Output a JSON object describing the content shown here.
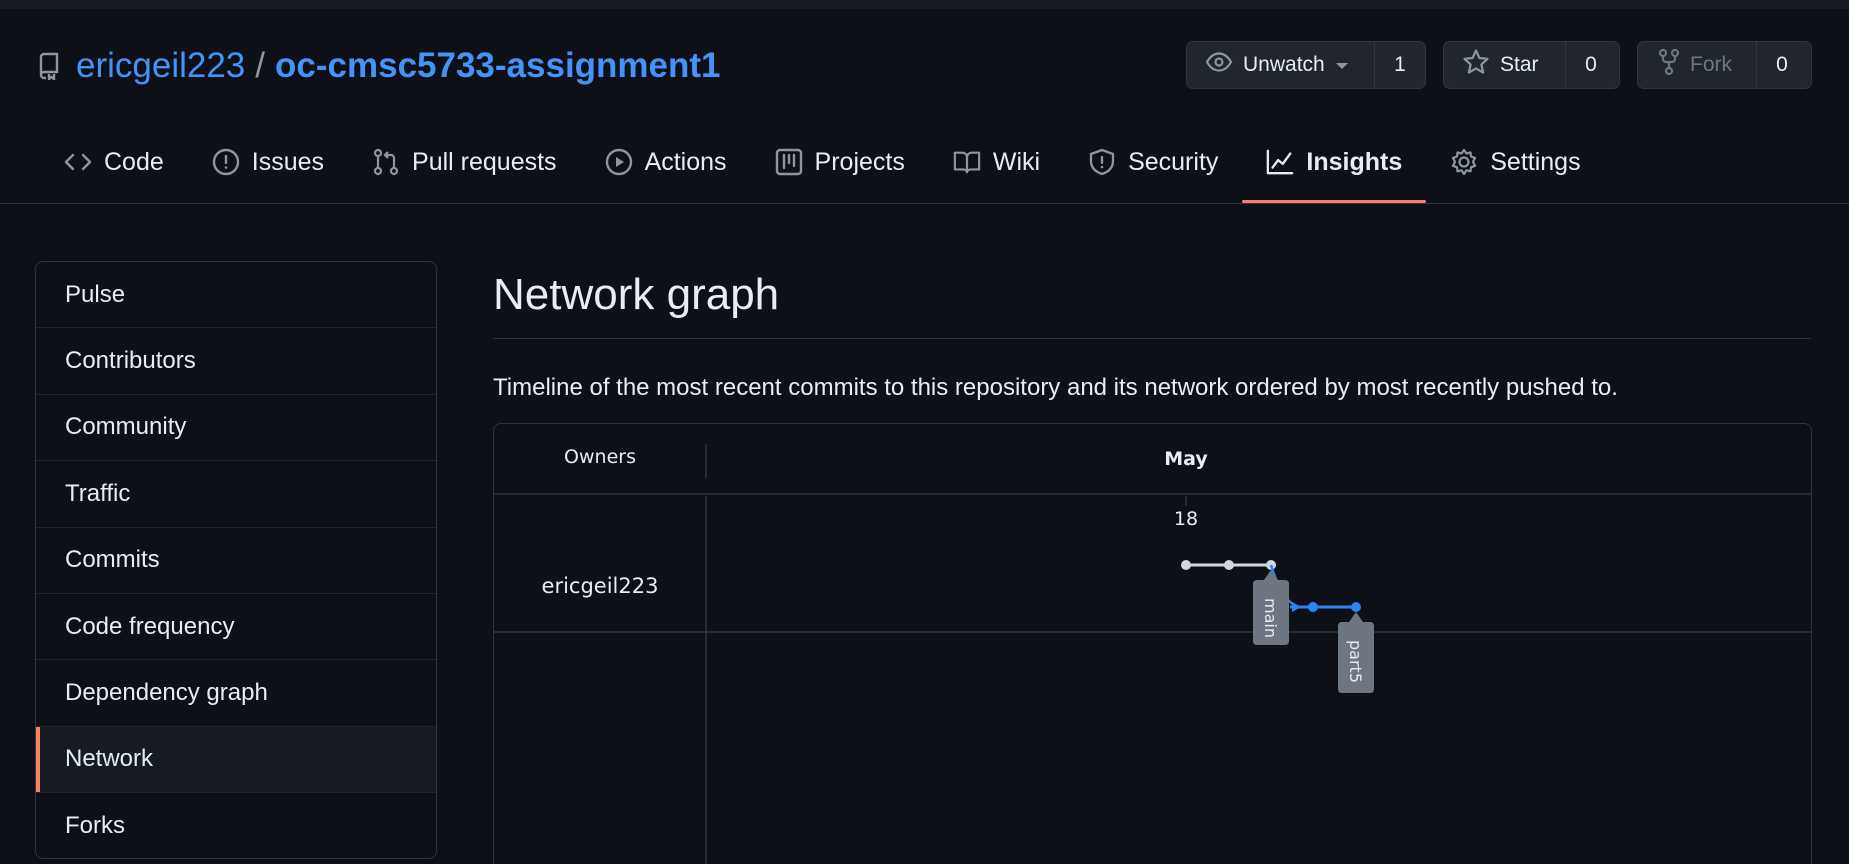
{
  "repo": {
    "owner": "ericgeil223",
    "separator": "/",
    "name": "oc-cmsc5733-assignment1"
  },
  "actions": {
    "watch": {
      "label": "Unwatch",
      "count": "1"
    },
    "star": {
      "label": "Star",
      "count": "0"
    },
    "fork": {
      "label": "Fork",
      "count": "0"
    }
  },
  "tabs": [
    {
      "label": "Code",
      "icon": "code-icon"
    },
    {
      "label": "Issues",
      "icon": "issue-icon"
    },
    {
      "label": "Pull requests",
      "icon": "pull-request-icon"
    },
    {
      "label": "Actions",
      "icon": "play-icon"
    },
    {
      "label": "Projects",
      "icon": "project-icon"
    },
    {
      "label": "Wiki",
      "icon": "book-icon"
    },
    {
      "label": "Security",
      "icon": "shield-icon"
    },
    {
      "label": "Insights",
      "icon": "graph-icon",
      "selected": true
    },
    {
      "label": "Settings",
      "icon": "gear-icon"
    }
  ],
  "sidebar": {
    "items": [
      {
        "label": "Pulse"
      },
      {
        "label": "Contributors"
      },
      {
        "label": "Community"
      },
      {
        "label": "Traffic"
      },
      {
        "label": "Commits"
      },
      {
        "label": "Code frequency"
      },
      {
        "label": "Dependency graph"
      },
      {
        "label": "Network",
        "active": true
      },
      {
        "label": "Forks"
      }
    ]
  },
  "main": {
    "title": "Network graph",
    "description": "Timeline of the most recent commits to this repository and its network ordered by most recently pushed to."
  },
  "network": {
    "owners_header": "Owners",
    "month": "May",
    "day": "18",
    "owner": "ericgeil223",
    "branches": [
      {
        "name": "main",
        "color": "#e6edf3",
        "commits": 3
      },
      {
        "name": "part5",
        "color": "#2f81f7",
        "commits": 2
      }
    ]
  },
  "colors": {
    "accent": "#f78166",
    "link": "#4493f8",
    "background": "#0d1117",
    "branch_label_bg": "#6e7681"
  }
}
